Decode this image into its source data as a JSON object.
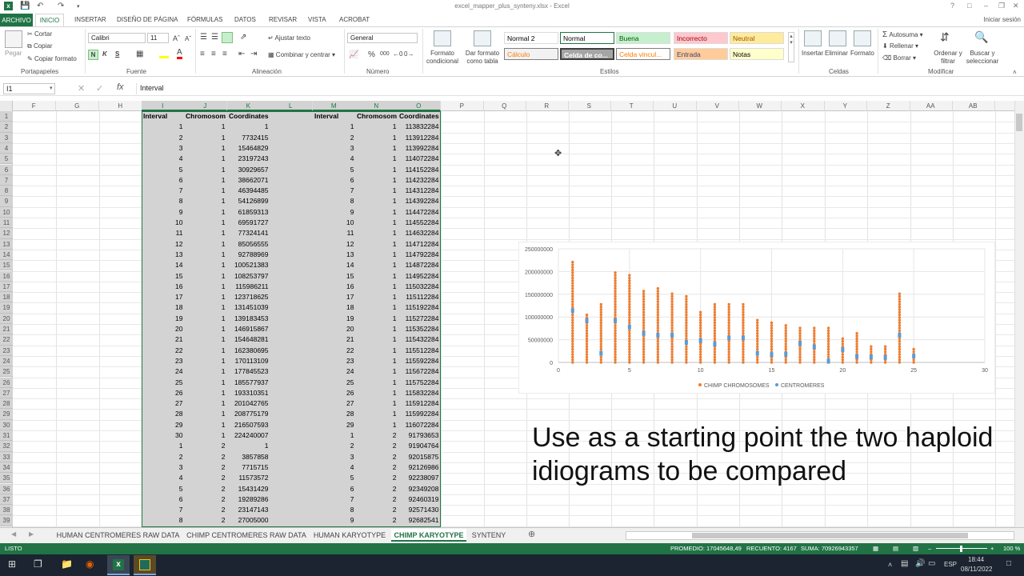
{
  "app": {
    "title": "excel_mapper_plus_synteny.xlsx - Excel",
    "sign_in": "Iniciar sesión",
    "qat": [
      "save-icon",
      "undo-icon",
      "redo-icon"
    ]
  },
  "ribbon_tabs": [
    "ARCHIVO",
    "INICIO",
    "INSERTAR",
    "DISEÑO DE PÁGINA",
    "FÓRMULAS",
    "DATOS",
    "REVISAR",
    "VISTA",
    "ACROBAT"
  ],
  "ribbon": {
    "clipboard": {
      "paste": "Pegar",
      "cut": "Cortar",
      "copy": "Copiar",
      "format_painter": "Copiar formato",
      "label": "Portapapeles"
    },
    "font": {
      "name": "Calibri",
      "size": "11",
      "bold": "N",
      "italic": "K",
      "underline": "S",
      "label": "Fuente"
    },
    "alignment": {
      "wrap": "Ajustar texto",
      "merge": "Combinar y centrar",
      "label": "Alineación"
    },
    "number": {
      "format": "General",
      "percent": "%",
      "thousands": "000",
      "label": "Número"
    },
    "styles_group": {
      "conditional": "Formato condicional",
      "table": "Dar formato como tabla",
      "label": "Estilos"
    },
    "styles": [
      {
        "label": "Normal 2",
        "bg": "#ffffff",
        "color": "#000000"
      },
      {
        "label": "Normal",
        "bg": "#ffffff",
        "color": "#000000"
      },
      {
        "label": "Buena",
        "bg": "#c6efce",
        "color": "#006100"
      },
      {
        "label": "Incorrecto",
        "bg": "#ffc7ce",
        "color": "#9c0006"
      },
      {
        "label": "Neutral",
        "bg": "#ffeb9c",
        "color": "#9c5700"
      },
      {
        "label": "Cálculo",
        "bg": "#f2f2f2",
        "color": "#fa7d00"
      },
      {
        "label": "Celda de co...",
        "bg": "#a5a5a5",
        "color": "#ffffff"
      },
      {
        "label": "Celda vincul...",
        "bg": "#ffffff",
        "color": "#fa7d00"
      },
      {
        "label": "Entrada",
        "bg": "#ffcc99",
        "color": "#3f3f76"
      },
      {
        "label": "Notas",
        "bg": "#ffffcc",
        "color": "#000000"
      }
    ],
    "cells": {
      "insert": "Insertar",
      "delete": "Eliminar",
      "format": "Formato",
      "label": "Celdas"
    },
    "editing": {
      "autosum": "Autosuma",
      "fill": "Rellenar",
      "clear": "Borrar",
      "sort": "Ordenar y filtrar",
      "find": "Buscar y seleccionar",
      "label": "Modificar"
    }
  },
  "formula_bar": {
    "name_box": "I1",
    "fx": "fx",
    "value": "Interval"
  },
  "columns": [
    "F",
    "G",
    "H",
    "I",
    "J",
    "K",
    "L",
    "M",
    "N",
    "O",
    "P",
    "Q",
    "R",
    "S",
    "T",
    "U",
    "V",
    "W",
    "X",
    "Y",
    "Z",
    "AA",
    "AB"
  ],
  "rows_start": 1,
  "rows_count": 39,
  "table_left": {
    "headers": [
      "Interval",
      "Chromosom",
      "Coordinates"
    ],
    "rows": [
      [
        "1",
        "1",
        "1"
      ],
      [
        "2",
        "1",
        "7732415"
      ],
      [
        "3",
        "1",
        "15464829"
      ],
      [
        "4",
        "1",
        "23197243"
      ],
      [
        "5",
        "1",
        "30929657"
      ],
      [
        "6",
        "1",
        "38662071"
      ],
      [
        "7",
        "1",
        "46394485"
      ],
      [
        "8",
        "1",
        "54126899"
      ],
      [
        "9",
        "1",
        "61859313"
      ],
      [
        "10",
        "1",
        "69591727"
      ],
      [
        "11",
        "1",
        "77324141"
      ],
      [
        "12",
        "1",
        "85056555"
      ],
      [
        "13",
        "1",
        "92788969"
      ],
      [
        "14",
        "1",
        "100521383"
      ],
      [
        "15",
        "1",
        "108253797"
      ],
      [
        "16",
        "1",
        "115986211"
      ],
      [
        "17",
        "1",
        "123718625"
      ],
      [
        "18",
        "1",
        "131451039"
      ],
      [
        "19",
        "1",
        "139183453"
      ],
      [
        "20",
        "1",
        "146915867"
      ],
      [
        "21",
        "1",
        "154648281"
      ],
      [
        "22",
        "1",
        "162380695"
      ],
      [
        "23",
        "1",
        "170113109"
      ],
      [
        "24",
        "1",
        "177845523"
      ],
      [
        "25",
        "1",
        "185577937"
      ],
      [
        "26",
        "1",
        "193310351"
      ],
      [
        "27",
        "1",
        "201042765"
      ],
      [
        "28",
        "1",
        "208775179"
      ],
      [
        "29",
        "1",
        "216507593"
      ],
      [
        "30",
        "1",
        "224240007"
      ],
      [
        "1",
        "2",
        "1"
      ],
      [
        "2",
        "2",
        "3857858"
      ],
      [
        "3",
        "2",
        "7715715"
      ],
      [
        "4",
        "2",
        "11573572"
      ],
      [
        "5",
        "2",
        "15431429"
      ],
      [
        "6",
        "2",
        "19289286"
      ],
      [
        "7",
        "2",
        "23147143"
      ],
      [
        "8",
        "2",
        "27005000"
      ]
    ]
  },
  "table_right": {
    "headers": [
      "Interval",
      "Chromosom",
      "Coordinates"
    ],
    "rows": [
      [
        "1",
        "1",
        "113832284"
      ],
      [
        "2",
        "1",
        "113912284"
      ],
      [
        "3",
        "1",
        "113992284"
      ],
      [
        "4",
        "1",
        "114072284"
      ],
      [
        "5",
        "1",
        "114152284"
      ],
      [
        "6",
        "1",
        "114232284"
      ],
      [
        "7",
        "1",
        "114312284"
      ],
      [
        "8",
        "1",
        "114392284"
      ],
      [
        "9",
        "1",
        "114472284"
      ],
      [
        "10",
        "1",
        "114552284"
      ],
      [
        "11",
        "1",
        "114632284"
      ],
      [
        "12",
        "1",
        "114712284"
      ],
      [
        "13",
        "1",
        "114792284"
      ],
      [
        "14",
        "1",
        "114872284"
      ],
      [
        "15",
        "1",
        "114952284"
      ],
      [
        "16",
        "1",
        "115032284"
      ],
      [
        "17",
        "1",
        "115112284"
      ],
      [
        "18",
        "1",
        "115192284"
      ],
      [
        "19",
        "1",
        "115272284"
      ],
      [
        "20",
        "1",
        "115352284"
      ],
      [
        "21",
        "1",
        "115432284"
      ],
      [
        "22",
        "1",
        "115512284"
      ],
      [
        "23",
        "1",
        "115592284"
      ],
      [
        "24",
        "1",
        "115672284"
      ],
      [
        "25",
        "1",
        "115752284"
      ],
      [
        "26",
        "1",
        "115832284"
      ],
      [
        "27",
        "1",
        "115912284"
      ],
      [
        "28",
        "1",
        "115992284"
      ],
      [
        "29",
        "1",
        "116072284"
      ],
      [
        "1",
        "2",
        "91793653"
      ],
      [
        "2",
        "2",
        "91904764"
      ],
      [
        "3",
        "2",
        "92015875"
      ],
      [
        "4",
        "2",
        "92126986"
      ],
      [
        "5",
        "2",
        "92238097"
      ],
      [
        "6",
        "2",
        "92349208"
      ],
      [
        "7",
        "2",
        "92460319"
      ],
      [
        "8",
        "2",
        "92571430"
      ],
      [
        "9",
        "2",
        "92682541"
      ]
    ]
  },
  "chart_data": {
    "type": "scatter",
    "x_ticks": [
      "0",
      "5",
      "10",
      "15",
      "20",
      "25",
      "30"
    ],
    "y_ticks": [
      "0",
      "50000000",
      "100000000",
      "150000000",
      "200000000",
      "250000000"
    ],
    "xlim": [
      0,
      30
    ],
    "ylim": [
      0,
      250000000
    ],
    "grid": true,
    "legend_position": "bottom",
    "series": [
      {
        "name": "CHIMP CHROMOSOMES",
        "color": "#ed7d31",
        "kind": "vertical-dotted-bars",
        "x": [
          1,
          2,
          3,
          4,
          5,
          6,
          7,
          8,
          9,
          10,
          11,
          12,
          13,
          14,
          15,
          16,
          17,
          18,
          19,
          20,
          21,
          22,
          23,
          24,
          25
        ],
        "y_max": [
          224000000,
          110000000,
          132000000,
          198000000,
          192000000,
          160000000,
          168000000,
          156000000,
          146000000,
          115000000,
          132000000,
          133000000,
          133000000,
          97000000,
          90000000,
          82000000,
          79000000,
          78000000,
          76000000,
          58000000,
          66000000,
          38000000,
          38000000,
          153000000,
          30000000
        ]
      },
      {
        "name": "CENTROMERES",
        "color": "#5b9bd5",
        "x": [
          1,
          2,
          3,
          4,
          5,
          6,
          7,
          8,
          9,
          10,
          11,
          12,
          13,
          14,
          15,
          16,
          17,
          18,
          19,
          20,
          21,
          22,
          23,
          24,
          25
        ],
        "y": [
          114000000,
          92000000,
          20000000,
          92000000,
          78000000,
          64000000,
          60000000,
          60000000,
          44000000,
          48000000,
          40000000,
          54000000,
          54000000,
          20000000,
          17000000,
          18000000,
          42000000,
          34000000,
          3000000,
          28000000,
          13000000,
          12000000,
          11000000,
          60000000,
          14000000
        ]
      }
    ]
  },
  "caption": "Use as a starting point the two haploid idiograms to be compared",
  "sheets": [
    "HUMAN CENTROMERES RAW DATA",
    "CHIMP CENTROMERES RAW DATA",
    "HUMAN KARYOTYPE",
    "CHIMP KARYOTYPE",
    "SYNTENY"
  ],
  "active_sheet": "CHIMP KARYOTYPE",
  "status": {
    "mode": "LISTO",
    "average": "PROMEDIO: 17045648,49",
    "count": "RECUENTO: 4167",
    "sum": "SUMA: 70926943357",
    "zoom": "100 %"
  },
  "taskbar": {
    "lang": "ESP",
    "time": "18:44",
    "date": "08/11/2022"
  }
}
